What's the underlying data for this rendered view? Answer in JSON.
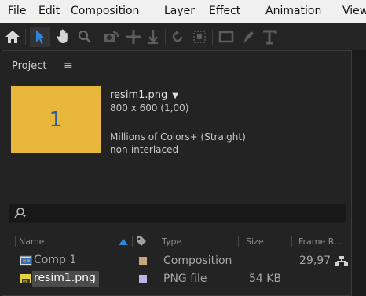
{
  "menu": {
    "items": [
      "File",
      "Edit",
      "Composition",
      "Layer",
      "Effect",
      "Animation",
      "View"
    ]
  },
  "toolbar": {
    "tools": [
      "home-icon",
      "selection-icon",
      "hand-icon",
      "zoom-icon",
      "orbit-camera-icon",
      "pan-behind-icon",
      "dolly-icon",
      "rotate-icon",
      "roto-brush-icon",
      "rectangle-icon",
      "pen-icon",
      "text-icon"
    ],
    "active_tool": "selection-icon"
  },
  "project_panel": {
    "title": "Project",
    "menu_glyph": "≡",
    "preview": {
      "thumbnail_text": "1",
      "name": "resim1.png",
      "dimensions": "800 x 600 (1,00)",
      "colors": "Millions of Colors+ (Straight)",
      "interlace": "non-interlaced"
    },
    "search": {
      "placeholder": ""
    },
    "columns": {
      "name": "Name",
      "type": "Type",
      "size": "Size",
      "frame_rate": "Frame R..."
    },
    "items": [
      {
        "name": "Comp 1",
        "icon": "composition-icon",
        "label_color": "#c9a57c",
        "type": "Composition",
        "size": "",
        "frame_rate": "29,97",
        "selected": false
      },
      {
        "name": "resim1.png",
        "icon": "png-file-icon",
        "label_color": "#b8b4ec",
        "type": "PNG file",
        "size": "54 KB",
        "frame_rate": "",
        "selected": true
      }
    ]
  },
  "colors": {
    "accent": "#2f86e0",
    "thumbnail": "#e8b63b"
  }
}
